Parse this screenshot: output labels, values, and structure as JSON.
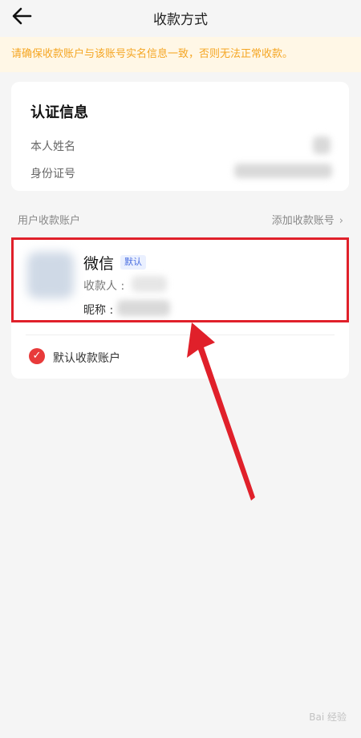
{
  "header": {
    "title": "收款方式",
    "back_icon": "arrow-left-icon"
  },
  "notice": {
    "text": "请确保收款账户与该账号实名信息一致，否则无法正常收款。"
  },
  "auth_card": {
    "title": "认证信息",
    "name_label": "本人姓名",
    "id_label": "身份证号"
  },
  "accounts_section": {
    "label": "用户收款账户",
    "add_label": "添加收款账号",
    "chevron_icon": "chevron-right-icon"
  },
  "account": {
    "name": "微信",
    "badge": "默认",
    "payee_label": "收款人 :",
    "nickname_label": "昵称 :",
    "default_checkbox_label": "默认收款账户",
    "checked": true,
    "check_icon": "check-icon"
  },
  "annotation": {
    "color": "#e0202a"
  },
  "watermark": {
    "text": "Bai 经验"
  }
}
